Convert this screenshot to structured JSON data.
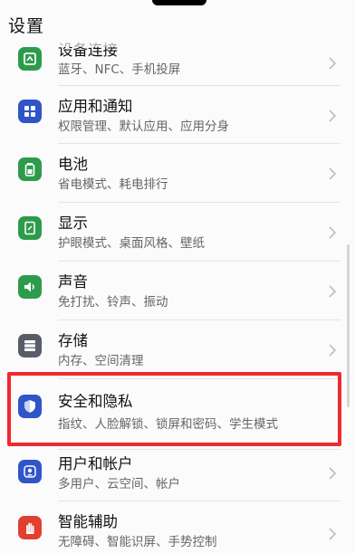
{
  "header": {
    "title": "设置"
  },
  "items": [
    {
      "label": "设备连接",
      "subtitle": "蓝牙、NFC、手机投屏",
      "icon": "device-connection-icon",
      "color": "#2e9b4c"
    },
    {
      "label": "应用和通知",
      "subtitle": "权限管理、默认应用、应用分身",
      "icon": "apps-icon",
      "color": "#2f55c8"
    },
    {
      "label": "电池",
      "subtitle": "省电模式、耗电排行",
      "icon": "battery-icon",
      "color": "#2e9b4c"
    },
    {
      "label": "显示",
      "subtitle": "护眼模式、桌面风格、壁纸",
      "icon": "display-icon",
      "color": "#2e9b4c"
    },
    {
      "label": "声音",
      "subtitle": "免打扰、铃声、振动",
      "icon": "sound-icon",
      "color": "#2e9b4c"
    },
    {
      "label": "存储",
      "subtitle": "内存、空间清理",
      "icon": "storage-icon",
      "color": "#585c68"
    },
    {
      "label": "安全和隐私",
      "subtitle": "指纹、人脸解锁、锁屏和密码、学生模式",
      "icon": "shield-icon",
      "color": "#2f55c8"
    },
    {
      "label": "用户和帐户",
      "subtitle": "多用户、云空间、帐户",
      "icon": "user-icon",
      "color": "#2f55c8"
    },
    {
      "label": "智能辅助",
      "subtitle": "无障碍、智能识屏、手势控制",
      "icon": "hand-icon",
      "color": "#e0402f"
    }
  ],
  "highlight_color": "#f0292d"
}
